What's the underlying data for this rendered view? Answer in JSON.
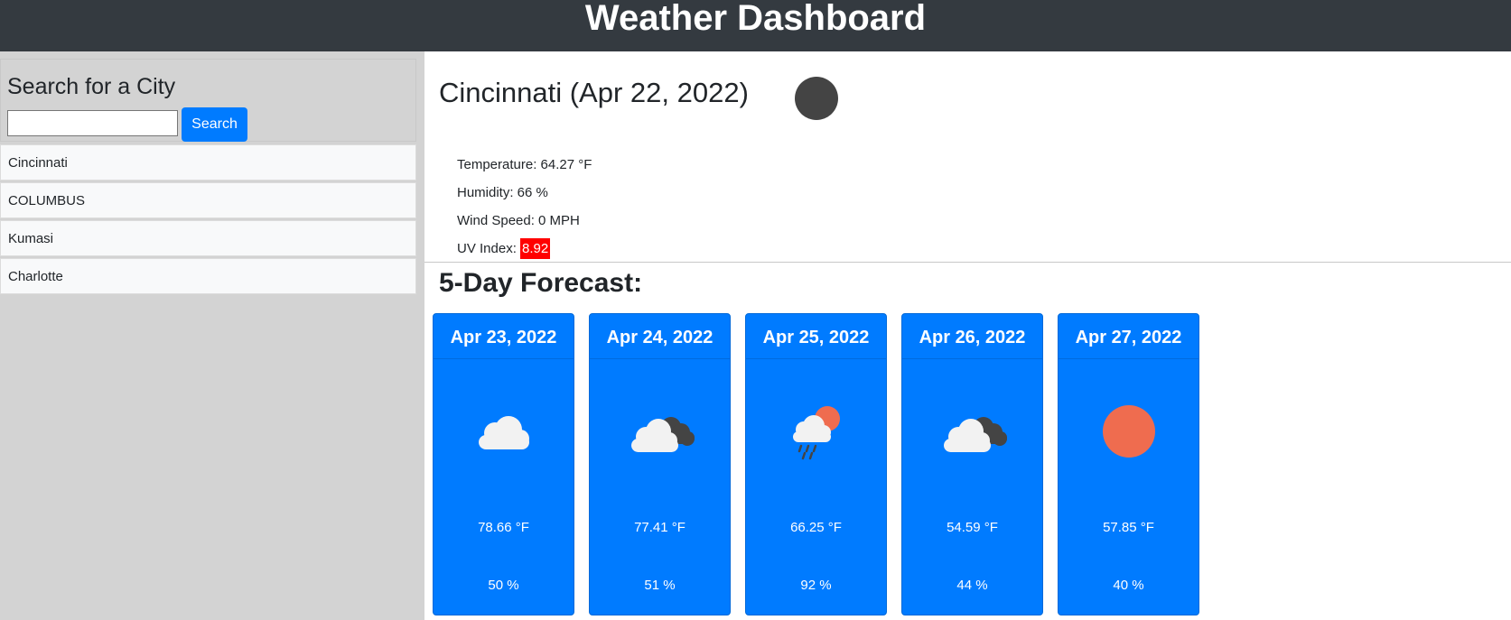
{
  "app": {
    "title": "Weather Dashboard"
  },
  "sidebar": {
    "heading": "Search for a City",
    "search": {
      "value": "",
      "placeholder": "",
      "button_label": "Search"
    },
    "history": [
      {
        "label": "Cincinnati"
      },
      {
        "label": "COLUMBUS"
      },
      {
        "label": "Kumasi"
      },
      {
        "label": "Charlotte"
      }
    ]
  },
  "current": {
    "title": "Cincinnati (Apr 22, 2022)",
    "icon": "dark-moon-icon",
    "temperature_label": "Temperature: 64.27 °F",
    "humidity_label": "Humidity: 66 %",
    "wind_label": "Wind Speed: 0 MPH",
    "uv_label": "UV Index:",
    "uv_value": "8.92",
    "uv_color": "#ff0000"
  },
  "forecast": {
    "title": "5-Day Forecast:",
    "days": [
      {
        "date": "Apr 23, 2022",
        "icon": "cloud-icon",
        "temp": "78.66 °F",
        "humidity": "50 %"
      },
      {
        "date": "Apr 24, 2022",
        "icon": "broken-clouds-icon",
        "temp": "77.41 °F",
        "humidity": "51 %"
      },
      {
        "date": "Apr 25, 2022",
        "icon": "rain-sun-cloud-icon",
        "temp": "66.25 °F",
        "humidity": "92 %"
      },
      {
        "date": "Apr 26, 2022",
        "icon": "broken-clouds-icon",
        "temp": "54.59 °F",
        "humidity": "44 %"
      },
      {
        "date": "Apr 27, 2022",
        "icon": "sun-icon",
        "temp": "57.85 °F",
        "humidity": "40 %"
      }
    ]
  },
  "colors": {
    "header_bg": "#343a40",
    "sidebar_bg": "#d3d3d3",
    "accent": "#007bff",
    "sun": "#ef6c4f"
  }
}
